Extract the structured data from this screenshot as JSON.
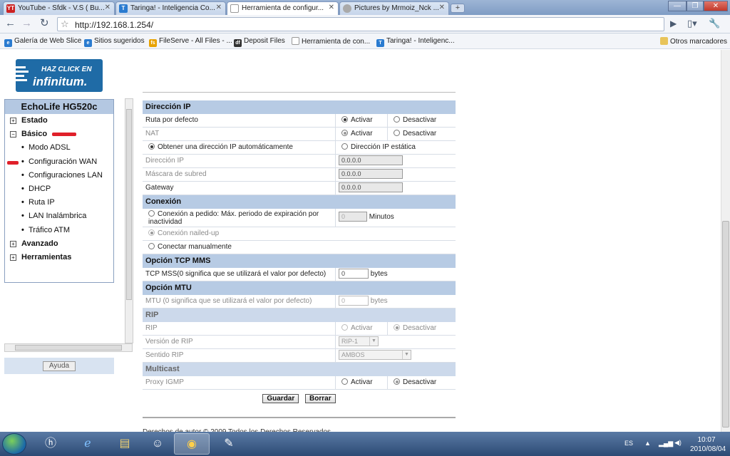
{
  "browser": {
    "tabs": [
      {
        "title": "YouTube - Sfdk - V.S ( Bu...",
        "favicon": "YT",
        "color": "#cc2222"
      },
      {
        "title": "Taringa! - Inteligencia Co...",
        "favicon": "T",
        "color": "#2a7bd0"
      },
      {
        "title": "Herramienta de configur...",
        "favicon": "",
        "color": "#ffffff"
      },
      {
        "title": "Pictures by Mrmoiz_Nck ...",
        "favicon": "",
        "color": "#999999"
      }
    ],
    "url": "http://192.168.1.254/",
    "bookmarks": [
      {
        "label": "Galería de Web Slice",
        "icon": "e"
      },
      {
        "label": "Sitios sugeridos",
        "icon": "e"
      },
      {
        "label": "FileServe - All Files - ...",
        "icon": "fs"
      },
      {
        "label": "Deposit Files",
        "icon": "df"
      },
      {
        "label": "Herramienta de con...",
        "icon": ""
      },
      {
        "label": "Taringa! - Inteligenc...",
        "icon": "T"
      }
    ],
    "other_bookmarks": "Otros marcadores"
  },
  "logo": {
    "line1": "HAZ CLICK EN",
    "line2": "infinitum."
  },
  "sidebar": {
    "title": "EchoLife HG520c",
    "items": [
      {
        "label": "Estado",
        "type": "top",
        "sign": "+"
      },
      {
        "label": "Básico",
        "type": "top",
        "sign": "−"
      },
      {
        "label": "Modo ADSL",
        "type": "sub"
      },
      {
        "label": "Configuración WAN",
        "type": "sub"
      },
      {
        "label": "Configuraciones LAN",
        "type": "sub"
      },
      {
        "label": "DHCP",
        "type": "sub"
      },
      {
        "label": "Ruta IP",
        "type": "sub"
      },
      {
        "label": "LAN Inalámbrica",
        "type": "sub"
      },
      {
        "label": "Tráfico ATM",
        "type": "sub"
      },
      {
        "label": "Avanzado",
        "type": "top",
        "sign": "+"
      },
      {
        "label": "Herramientas",
        "type": "top",
        "sign": "+"
      }
    ],
    "help": "Ayuda"
  },
  "form": {
    "ip_section": "Dirección IP",
    "default_route": {
      "label": "Ruta por defecto",
      "opt1": "Activar",
      "opt2": "Desactivar"
    },
    "nat": {
      "label": "NAT",
      "opt1": "Activar",
      "opt2": "Desactivar"
    },
    "obtain_auto": "Obtener una dirección IP automáticamente",
    "static_ip": "Dirección IP estática",
    "ip_address": {
      "label": "Dirección IP",
      "value": "0.0.0.0"
    },
    "subnet_mask": {
      "label": "Máscara de subred",
      "value": "0.0.0.0"
    },
    "gateway": {
      "label": "Gateway",
      "value": "0.0.0.0"
    },
    "connection_section": "Conexión",
    "on_demand": "Conexión a pedido: Máx. periodo de expiración por inactividad",
    "on_demand_value": "0",
    "minutes": "Minutos",
    "nailed_up": "Conexión nailed-up",
    "manual": "Conectar manualmente",
    "tcp_section": "Opción TCP MMS",
    "tcp_mss": {
      "label": "TCP MSS(0 significa que se utilizará el valor por defecto)",
      "value": "0",
      "unit": "bytes"
    },
    "mtu_section": "Opción MTU",
    "mtu": {
      "label": "MTU (0 significa que se utilizará el valor por defecto)",
      "value": "0",
      "unit": "bytes"
    },
    "rip_section": "RIP",
    "rip": {
      "label": "RIP",
      "opt1": "Activar",
      "opt2": "Desactivar"
    },
    "rip_version": {
      "label": "Versión de RIP",
      "value": "RIP-1"
    },
    "rip_direction": {
      "label": "Sentido RIP",
      "value": "AMBOS"
    },
    "multicast_section": "Multicast",
    "igmp": {
      "label": "Proxy IGMP",
      "opt1": "Activar",
      "opt2": "Desactivar"
    },
    "save": "Guardar",
    "delete": "Borrar"
  },
  "footer": "Derechos de autor © 2009 Todos los Derechos Reservados",
  "taskbar": {
    "lang": "ES",
    "time": "10:07",
    "date": "2010/08/04"
  }
}
